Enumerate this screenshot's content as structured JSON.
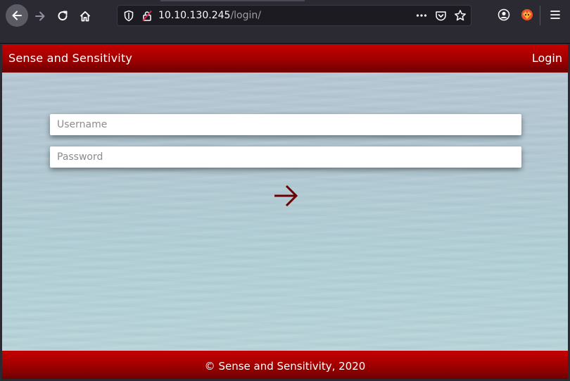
{
  "browser": {
    "url_host": "10.10.130.245",
    "url_path": "/login/"
  },
  "site": {
    "title": "Sense and Sensitivity",
    "nav_login": "Login",
    "footer": "© Sense and Sensitivity, 2020"
  },
  "form": {
    "username_placeholder": "Username",
    "password_placeholder": "Password",
    "submit_icon": "arrow-right-icon"
  },
  "colors": {
    "brand_red": "#9e0000",
    "arrow": "#6b0000"
  }
}
